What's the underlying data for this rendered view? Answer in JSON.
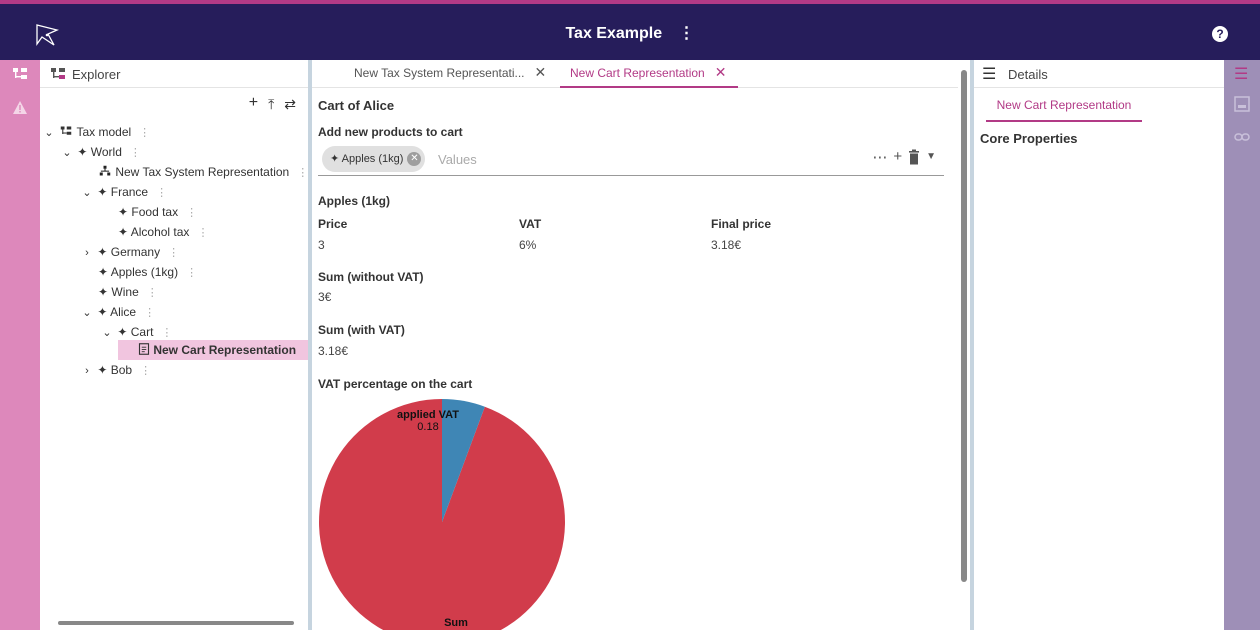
{
  "header": {
    "title": "Tax Example",
    "menu_glyph": "⋮",
    "help_glyph": "?"
  },
  "explorer": {
    "title": "Explorer",
    "tree": [
      {
        "label": "Tax model",
        "icon": "model-icon"
      },
      {
        "label": "World",
        "icon": "element-icon"
      },
      {
        "label": "New Tax System Representation",
        "icon": "hierarchy-icon"
      },
      {
        "label": "France",
        "icon": "element-icon"
      },
      {
        "label": "Food tax",
        "icon": "element-icon"
      },
      {
        "label": "Alcohol tax",
        "icon": "element-icon"
      },
      {
        "label": "Germany",
        "icon": "element-icon"
      },
      {
        "label": "Apples (1kg)",
        "icon": "element-icon"
      },
      {
        "label": "Wine",
        "icon": "element-icon"
      },
      {
        "label": "Alice",
        "icon": "element-icon"
      },
      {
        "label": "Cart",
        "icon": "element-icon"
      },
      {
        "label": "New Cart Representation",
        "icon": "form-icon"
      },
      {
        "label": "Bob",
        "icon": "element-icon"
      }
    ]
  },
  "tabs": [
    {
      "label": "New Tax System Representati..."
    },
    {
      "label": "New Cart Representation"
    }
  ],
  "cart": {
    "title": "Cart of Alice",
    "add_label": "Add new products to cart",
    "chip": "Apples (1kg)",
    "values_placeholder": "Values",
    "product_title": "Apples (1kg)",
    "columns": [
      "Price",
      "VAT",
      "Final price"
    ],
    "row": [
      "3",
      "6%",
      "3.18€"
    ],
    "sum_without_label": "Sum (without VAT)",
    "sum_without_value": "3€",
    "sum_with_label": "Sum (with VAT)",
    "sum_with_value": "3.18€",
    "chart_title": "VAT percentage on the cart"
  },
  "chart_data": {
    "type": "pie",
    "title": "VAT percentage on the cart",
    "slices": [
      {
        "label": "Sum",
        "value": 3,
        "color": "#d13c4b"
      },
      {
        "label": "applied VAT",
        "value": 0.18,
        "color": "#3f86b5"
      }
    ]
  },
  "details": {
    "title": "Details",
    "tab": "New Cart Representation",
    "section": "Core Properties"
  },
  "colors": {
    "accent": "#b23a86",
    "header_bg": "#261d5b",
    "left_rail": "#dd88bb",
    "right_rail": "#9e8fb7"
  }
}
